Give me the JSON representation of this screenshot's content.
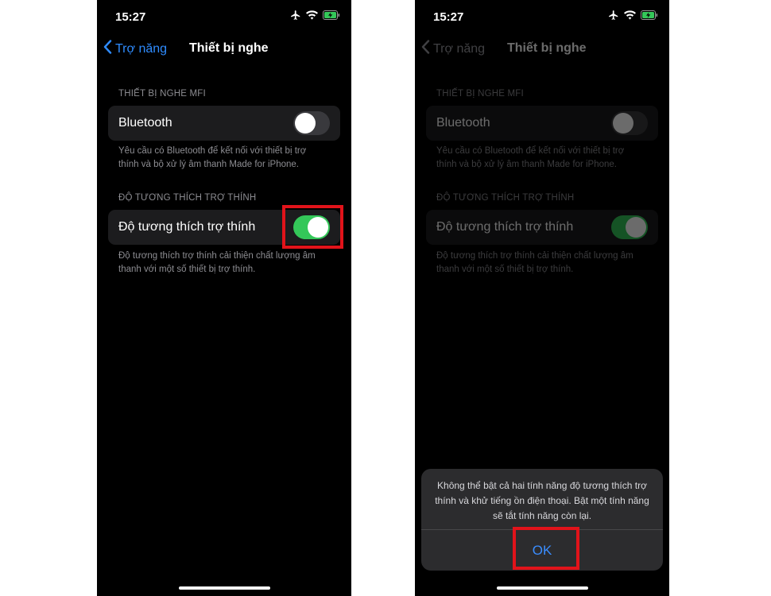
{
  "left_screen": {
    "status": {
      "time": "15:27"
    },
    "nav": {
      "back_label": "Trợ năng",
      "title": "Thiết bị nghe"
    },
    "mfi_section": {
      "header": "THIẾT BỊ NGHE MFI",
      "bluetooth_label": "Bluetooth",
      "bluetooth_on": false,
      "footer": "Yêu cầu có Bluetooth để kết nối với thiết bị trợ thính và bộ xử lý âm thanh Made for iPhone."
    },
    "hac_section": {
      "header": "ĐỘ TƯƠNG THÍCH TRỢ THÍNH",
      "label": "Độ tương thích trợ thính",
      "on": true,
      "footer": "Độ tương thích trợ thính cải thiện chất lượng âm thanh với một số thiết bị trợ thính."
    }
  },
  "right_screen": {
    "status": {
      "time": "15:27"
    },
    "nav": {
      "back_label": "Trợ năng",
      "title": "Thiết bị nghe"
    },
    "mfi_section": {
      "header": "THIẾT BỊ NGHE MFI",
      "bluetooth_label": "Bluetooth",
      "bluetooth_on": false,
      "footer": "Yêu cầu có Bluetooth để kết nối với thiết bị trợ thính và bộ xử lý âm thanh Made for iPhone."
    },
    "hac_section": {
      "header": "ĐỘ TƯƠNG THÍCH TRỢ THÍNH",
      "label": "Độ tương thích trợ thính",
      "on": true,
      "footer": "Độ tương thích trợ thính cải thiện chất lượng âm thanh với một số thiết bị trợ thính."
    },
    "alert": {
      "message": "Không thể bật cả hai tính năng độ tương thích trợ thính và khử tiếng ồn điện thoại. Bật một tính năng sẽ tắt tính năng còn lại.",
      "ok_label": "OK"
    }
  },
  "colors": {
    "highlight": "#e1131a",
    "toggle_on": "#34c759",
    "link": "#2f8cff"
  },
  "icons": [
    "chevron-left-icon",
    "airplane-icon",
    "wifi-icon",
    "battery-charging-icon"
  ]
}
